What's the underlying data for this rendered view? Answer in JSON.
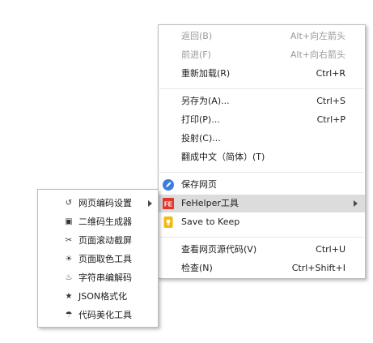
{
  "context_menu": {
    "items": [
      {
        "label": "返回(B)",
        "shortcut": "Alt+向左箭头",
        "enabled": false
      },
      {
        "label": "前进(F)",
        "shortcut": "Alt+向右箭头",
        "enabled": false
      },
      {
        "label": "重新加载(R)",
        "shortcut": "Ctrl+R",
        "enabled": true
      },
      {
        "label": "另存为(A)...",
        "shortcut": "Ctrl+S",
        "enabled": true
      },
      {
        "label": "打印(P)...",
        "shortcut": "Ctrl+P",
        "enabled": true
      },
      {
        "label": "投射(C)...",
        "shortcut": "",
        "enabled": true
      },
      {
        "label": "翻成中文（简体）(T)",
        "shortcut": "",
        "enabled": true
      },
      {
        "label": "保存网页",
        "icon": "save-page-icon",
        "icon_color": "#3b7ee0"
      },
      {
        "label": "FeHelper工具",
        "icon": "fehelper-icon",
        "icon_color": "#e0362b",
        "icon_text": "FE",
        "has_submenu": true,
        "highlighted": true
      },
      {
        "label": "Save to Keep",
        "icon": "keep-icon",
        "icon_color": "#f5b90f"
      },
      {
        "label": "查看网页源代码(V)",
        "shortcut": "Ctrl+U",
        "enabled": true
      },
      {
        "label": "检查(N)",
        "shortcut": "Ctrl+Shift+I",
        "enabled": true
      }
    ]
  },
  "fehelper_submenu": {
    "items": [
      {
        "label": "网页编码设置",
        "icon": "refresh-icon",
        "glyph": "↺",
        "has_submenu": true
      },
      {
        "label": "二维码生成器",
        "icon": "qrcode-icon",
        "glyph": "▣"
      },
      {
        "label": "页面滚动截屏",
        "icon": "scissors-icon",
        "glyph": "✂"
      },
      {
        "label": "页面取色工具",
        "icon": "sun-icon",
        "glyph": "☀"
      },
      {
        "label": "字符串编解码",
        "icon": "hot-springs-icon",
        "glyph": "♨"
      },
      {
        "label": "JSON格式化",
        "icon": "star-icon",
        "glyph": "★"
      },
      {
        "label": "代码美化工具",
        "icon": "umbrella-icon",
        "glyph": "☂"
      }
    ]
  },
  "colors": {
    "highlight_bg": "#dcdcdc",
    "disabled_text": "#9a9a9a",
    "text": "#202020"
  }
}
